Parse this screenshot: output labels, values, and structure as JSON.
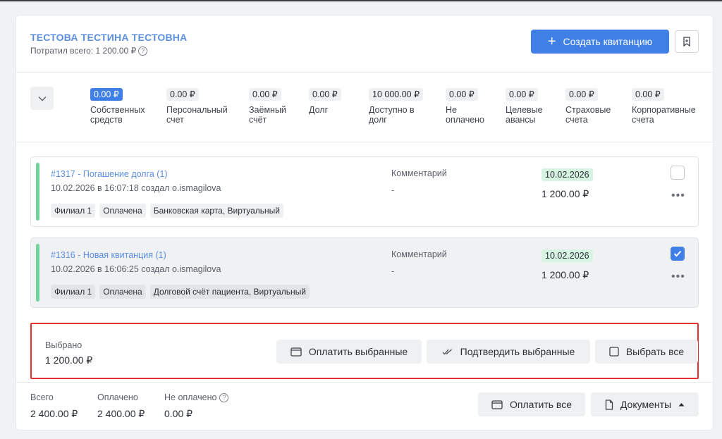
{
  "client": {
    "name": "ТЕСТОВА ТЕСТИНА ТЕСТОВНА",
    "spent_label": "Потратил всего: 1 200.00 ₽"
  },
  "actions": {
    "create_receipt": "Создать квитанцию",
    "create_icon": "plus-icon",
    "bookmark_icon": "bookmark-icon"
  },
  "balances": [
    {
      "amount": "0.00 ₽",
      "label1": "Собственных",
      "label2": "средств",
      "active": true
    },
    {
      "amount": "0.00 ₽",
      "label1": "Персональный",
      "label2": "счет"
    },
    {
      "amount": "0.00 ₽",
      "label1": "Заёмный",
      "label2": "счёт"
    },
    {
      "amount": "0.00 ₽",
      "label1": "Долг",
      "label2": ""
    },
    {
      "amount": "10 000.00 ₽",
      "label1": "Доступно в",
      "label2": "долг"
    },
    {
      "amount": "0.00 ₽",
      "label1": "Не",
      "label2": "оплачено"
    },
    {
      "amount": "0.00 ₽",
      "label1": "Целевые",
      "label2": "авансы"
    },
    {
      "amount": "0.00 ₽",
      "label1": "Страховые",
      "label2": "счета"
    },
    {
      "amount": "0.00 ₽",
      "label1": "Корпоративные",
      "label2": "счета"
    }
  ],
  "receipts": [
    {
      "title": "#1317 - Погашение долга (1)",
      "meta": "10.02.2026 в 16:07:18 создал o.ismagilova",
      "tags": [
        "Филиал 1",
        "Оплачена",
        "Банковская карта, Виртуальный"
      ],
      "comment_label": "Комментарий",
      "comment": "-",
      "date": "10.02.2026",
      "sum": "1 200.00 ₽",
      "checked": false,
      "more": "•••"
    },
    {
      "title": "#1316 - Новая квитанция (1)",
      "meta": "10.02.2026 в 16:06:25 создал o.ismagilova",
      "tags": [
        "Филиал 1",
        "Оплачена",
        "Долговой счёт пациента, Виртуальный"
      ],
      "comment_label": "Комментарий",
      "comment": "-",
      "date": "10.02.2026",
      "sum": "1 200.00 ₽",
      "checked": true,
      "more": "•••"
    }
  ],
  "selection": {
    "label": "Выбрано",
    "amount": "1 200.00 ₽",
    "pay_selected": "Оплатить выбранные",
    "confirm_selected": "Подтвердить выбранные",
    "select_all": "Выбрать все"
  },
  "totals": {
    "total_label": "Всего",
    "total_value": "2 400.00 ₽",
    "paid_label": "Оплачено",
    "paid_value": "2 400.00 ₽",
    "unpaid_label": "Не оплачено",
    "unpaid_value": "0.00 ₽",
    "help_glyph": "?"
  },
  "footer": {
    "pay_all": "Оплатить все",
    "documents": "Документы"
  },
  "colors": {
    "accent": "#3f7fe6",
    "paid_bar": "#6fd39a",
    "date_badge": "#d7f4e3",
    "highlight": "#e53030"
  }
}
